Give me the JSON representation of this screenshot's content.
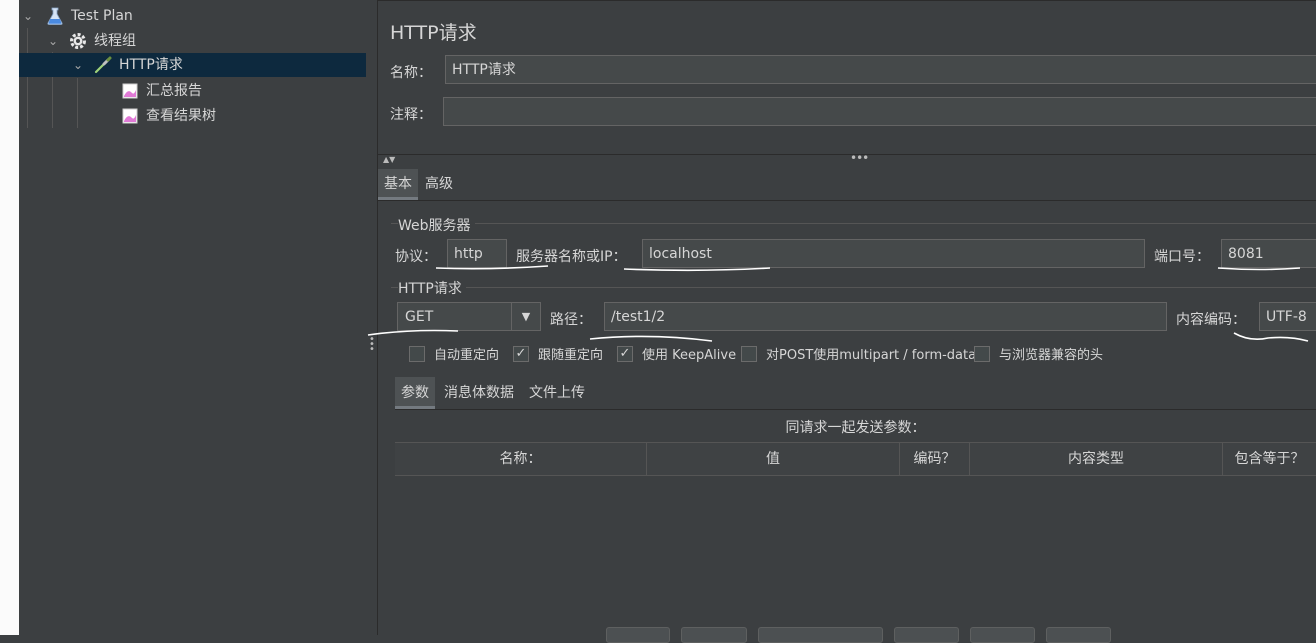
{
  "tree": {
    "items": [
      {
        "label": "Test Plan"
      },
      {
        "label": "线程组"
      },
      {
        "label": "HTTP请求"
      },
      {
        "label": "汇总报告"
      },
      {
        "label": "查看结果树"
      }
    ]
  },
  "panel": {
    "title": "HTTP请求",
    "name_label": "名称：",
    "name_value": "HTTP请求",
    "comment_label": "注释：",
    "comment_value": ""
  },
  "tabs": [
    "基本",
    "高级"
  ],
  "web_server": {
    "group_title": "Web服务器",
    "protocol_label": "协议：",
    "protocol_value": "http",
    "server_label": "服务器名称或IP：",
    "server_value": "localhost",
    "port_label": "端口号：",
    "port_value": "8081"
  },
  "http_request": {
    "group_title": "HTTP请求",
    "method": "GET",
    "path_label": "路径：",
    "path_value": "/test1/2",
    "encoding_label": "内容编码：",
    "encoding_value": "UTF-8"
  },
  "checkboxes": [
    {
      "label": "自动重定向",
      "checked": false
    },
    {
      "label": "跟随重定向",
      "checked": true
    },
    {
      "label": "使用 KeepAlive",
      "checked": true
    },
    {
      "label": "对POST使用multipart / form-data",
      "checked": false
    },
    {
      "label": "与浏览器兼容的头",
      "checked": false
    }
  ],
  "subtabs": [
    "参数",
    "消息体数据",
    "文件上传"
  ],
  "params_table": {
    "caption": "同请求一起发送参数：",
    "columns": [
      "名称：",
      "值",
      "编码？",
      "内容类型",
      "包含等于？"
    ]
  },
  "colors": {
    "background": "#3c3f41",
    "selection": "#0d293e",
    "field": "#45494a",
    "text": "#d6d6d6"
  }
}
